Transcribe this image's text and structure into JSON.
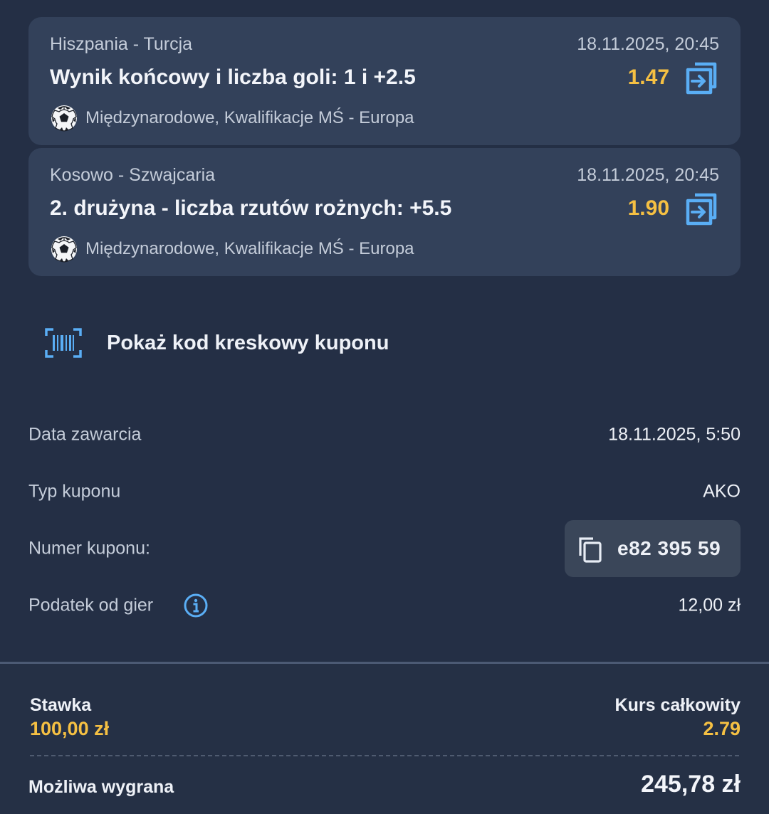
{
  "bets": [
    {
      "match": "Hiszpania - Turcja",
      "datetime": "18.11.2025, 20:45",
      "market": "Wynik końcowy i liczba goli: 1 i +2.5",
      "odds": "1.47",
      "league": "Międzynarodowe, Kwalifikacje MŚ - Europa",
      "sport_icon": "soccer-ball-icon"
    },
    {
      "match": "Kosowo - Szwajcaria",
      "datetime": "18.11.2025, 20:45",
      "market": "2. drużyna - liczba rzutów rożnych: +5.5",
      "odds": "1.90",
      "league": "Międzynarodowe, Kwalifikacje MŚ - Europa",
      "sport_icon": "soccer-ball-icon"
    }
  ],
  "barcode": {
    "label": "Pokaż kod kreskowy kuponu",
    "icon": "barcode-icon"
  },
  "details": {
    "date_label": "Data zawarcia",
    "date_value": "18.11.2025, 5:50",
    "type_label": "Typ kuponu",
    "type_value": "AKO",
    "number_label": "Numer kuponu:",
    "number_value": "e82 395 59",
    "tax_label": "Podatek od gier",
    "tax_value": "12,00 zł"
  },
  "summary": {
    "stake_label": "Stawka",
    "stake_value": "100,00 zł",
    "total_odds_label": "Kurs całkowity",
    "total_odds_value": "2.79",
    "win_label": "Możliwa wygrana",
    "win_value": "245,78 zł"
  },
  "colors": {
    "background": "#242f45",
    "card": "#33415a",
    "accent_odds": "#f5c043",
    "icon_blue": "#5aaef5"
  }
}
